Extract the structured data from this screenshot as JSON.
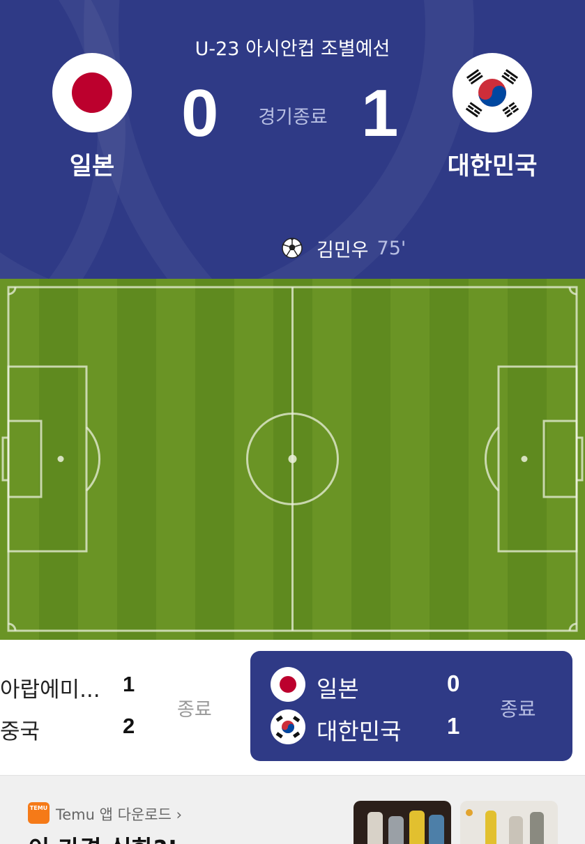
{
  "match": {
    "league": "U-23 아시안컵 조별예선",
    "status": "경기종료",
    "home": {
      "name": "일본",
      "score": "0",
      "flag": "japan-flag"
    },
    "away": {
      "name": "대한민국",
      "score": "1",
      "flag": "korea-flag"
    },
    "goals": [
      {
        "scorer": "김민우",
        "minute": "75'"
      }
    ]
  },
  "other_matches": {
    "previous": {
      "teams": [
        {
          "name": "아랍에미...",
          "score": "1"
        },
        {
          "name": "중국",
          "score": "2"
        }
      ],
      "status": "종료"
    },
    "current": {
      "teams": [
        {
          "name": "일본",
          "score": "0"
        },
        {
          "name": "대한민국",
          "score": "1"
        }
      ],
      "status": "종료"
    }
  },
  "ad": {
    "brand": "TEMU",
    "label": "Temu 앱 다운로드 ›",
    "headline": "이 가격 실화?!"
  },
  "colors": {
    "header_bg": "#2f3a86",
    "pitch_green": "#5f8a1f",
    "temu_orange": "#f57a18",
    "korea_red": "#cd2e3a",
    "korea_blue": "#0047a0",
    "japan_red": "#bc002d"
  }
}
